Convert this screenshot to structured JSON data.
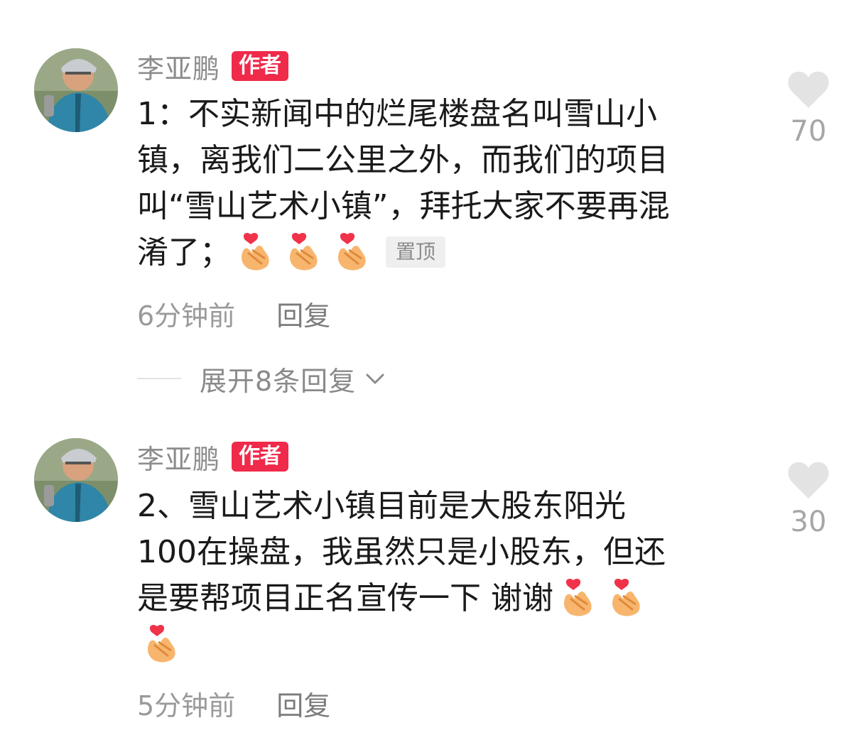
{
  "comments": [
    {
      "author": "李亚鹏",
      "badge": "作者",
      "text_lines": [
        "1：不实新闻中的烂尾楼盘名叫雪山小",
        "镇，离我们二公里之外，而我们的项目",
        "叫“雪山艺术小镇”，拜托大家不要再混",
        "淆了；"
      ],
      "emoji_icon": "finger-heart-icon",
      "pin_label": "置顶",
      "time": "6分钟前",
      "reply_label": "回复",
      "likes": "70"
    },
    {
      "author": "李亚鹏",
      "badge": "作者",
      "text_lines": [
        "2、雪山艺术小镇目前是大股东阳光",
        "100在操盘，我虽然只是小股东，但还",
        "是要帮项目正名宣传一下 谢谢"
      ],
      "emoji_icon": "finger-heart-icon",
      "time": "5分钟前",
      "reply_label": "回复",
      "likes": "30"
    }
  ],
  "expand_replies": {
    "label": "展开8条回复"
  },
  "colors": {
    "badge": "#ef2a4a",
    "heart": "#e3e3e3",
    "meta": "#9a9a9a",
    "text": "#1a1a1a"
  }
}
